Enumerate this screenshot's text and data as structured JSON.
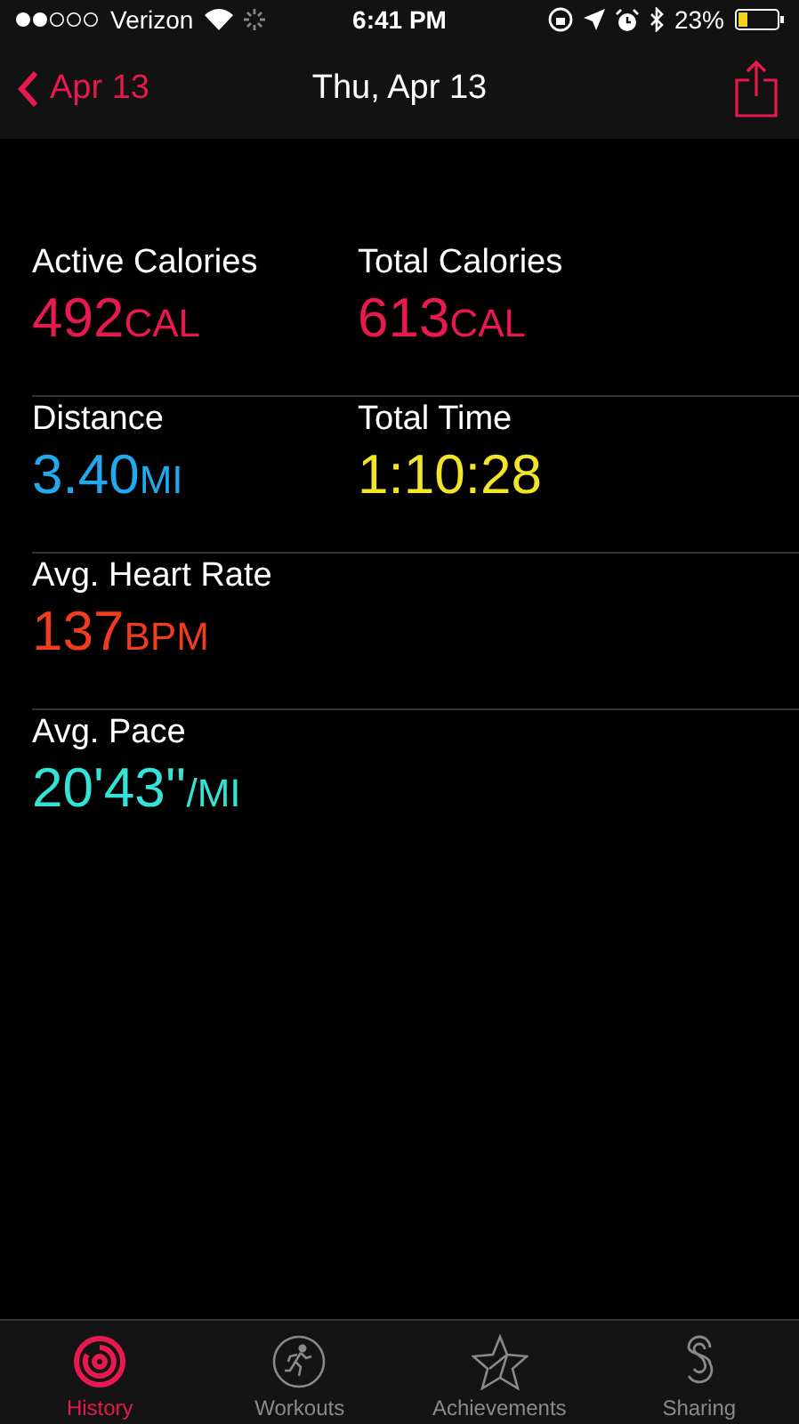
{
  "status_bar": {
    "carrier": "Verizon",
    "time": "6:41 PM",
    "battery": "23%"
  },
  "nav": {
    "back": "Apr 13",
    "title": "Thu, Apr 13"
  },
  "rows": [
    {
      "cells": [
        {
          "label": "Active Calories",
          "value": "492",
          "unit": "CAL",
          "color": "#e8194f"
        },
        {
          "label": "Total Calories",
          "value": "613",
          "unit": "CAL",
          "color": "#e8194f"
        }
      ]
    },
    {
      "cells": [
        {
          "label": "Distance",
          "value": "3.40",
          "unit": "MI",
          "color": "#22a8ec"
        },
        {
          "label": "Total Time",
          "value": "1:10:28",
          "color": "#f2e426"
        }
      ]
    },
    {
      "cells": [
        {
          "label": "Avg. Heart Rate",
          "value": "137",
          "unit": "BPM",
          "color": "#f23c1e"
        }
      ]
    },
    {
      "cells": [
        {
          "label": "Avg. Pace",
          "value": "20'43''",
          "unit": "/MI",
          "color": "#34e2d6"
        }
      ]
    }
  ],
  "tabs": [
    {
      "kind": "history",
      "label": "History",
      "selected": true
    },
    {
      "kind": "workouts",
      "label": "Workouts",
      "selected": false
    },
    {
      "kind": "achievements",
      "label": "Achievements",
      "selected": false
    },
    {
      "kind": "sharing",
      "label": "Sharing",
      "selected": false
    }
  ]
}
